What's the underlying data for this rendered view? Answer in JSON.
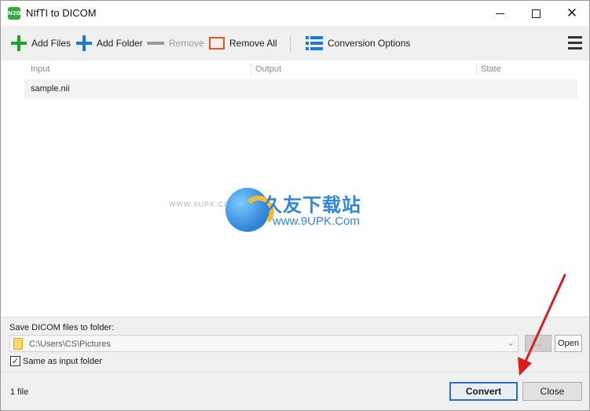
{
  "window": {
    "icon_text": "N2D",
    "title": "NIfTI to DICOM"
  },
  "toolbar": {
    "add_files": "Add Files",
    "add_folder": "Add Folder",
    "remove": "Remove",
    "remove_all": "Remove All",
    "conversion_options": "Conversion Options",
    "colors": {
      "add_files_icon": "#1aa52a",
      "add_folder_icon": "#1a7ad6",
      "remove_all_icon": "#e8551c"
    }
  },
  "table": {
    "columns": [
      "Input",
      "Output",
      "State"
    ],
    "rows": [
      {
        "input": "sample.nii",
        "output": "",
        "state": ""
      }
    ]
  },
  "watermark": {
    "chinese": "久友下载站",
    "url": "www.9UPK.Com",
    "small": "WWW.9UPK.COM"
  },
  "output": {
    "save_label": "Save DICOM files to folder:",
    "path": "C:\\Users\\CS\\Pictures",
    "browse_label": "...",
    "open_label": "Open",
    "same_as_input_label": "Same as input folder",
    "same_as_input_checked": true,
    "check_mark": "✓"
  },
  "status": {
    "file_count": "1 file",
    "convert_label": "Convert",
    "close_label": "Close"
  }
}
